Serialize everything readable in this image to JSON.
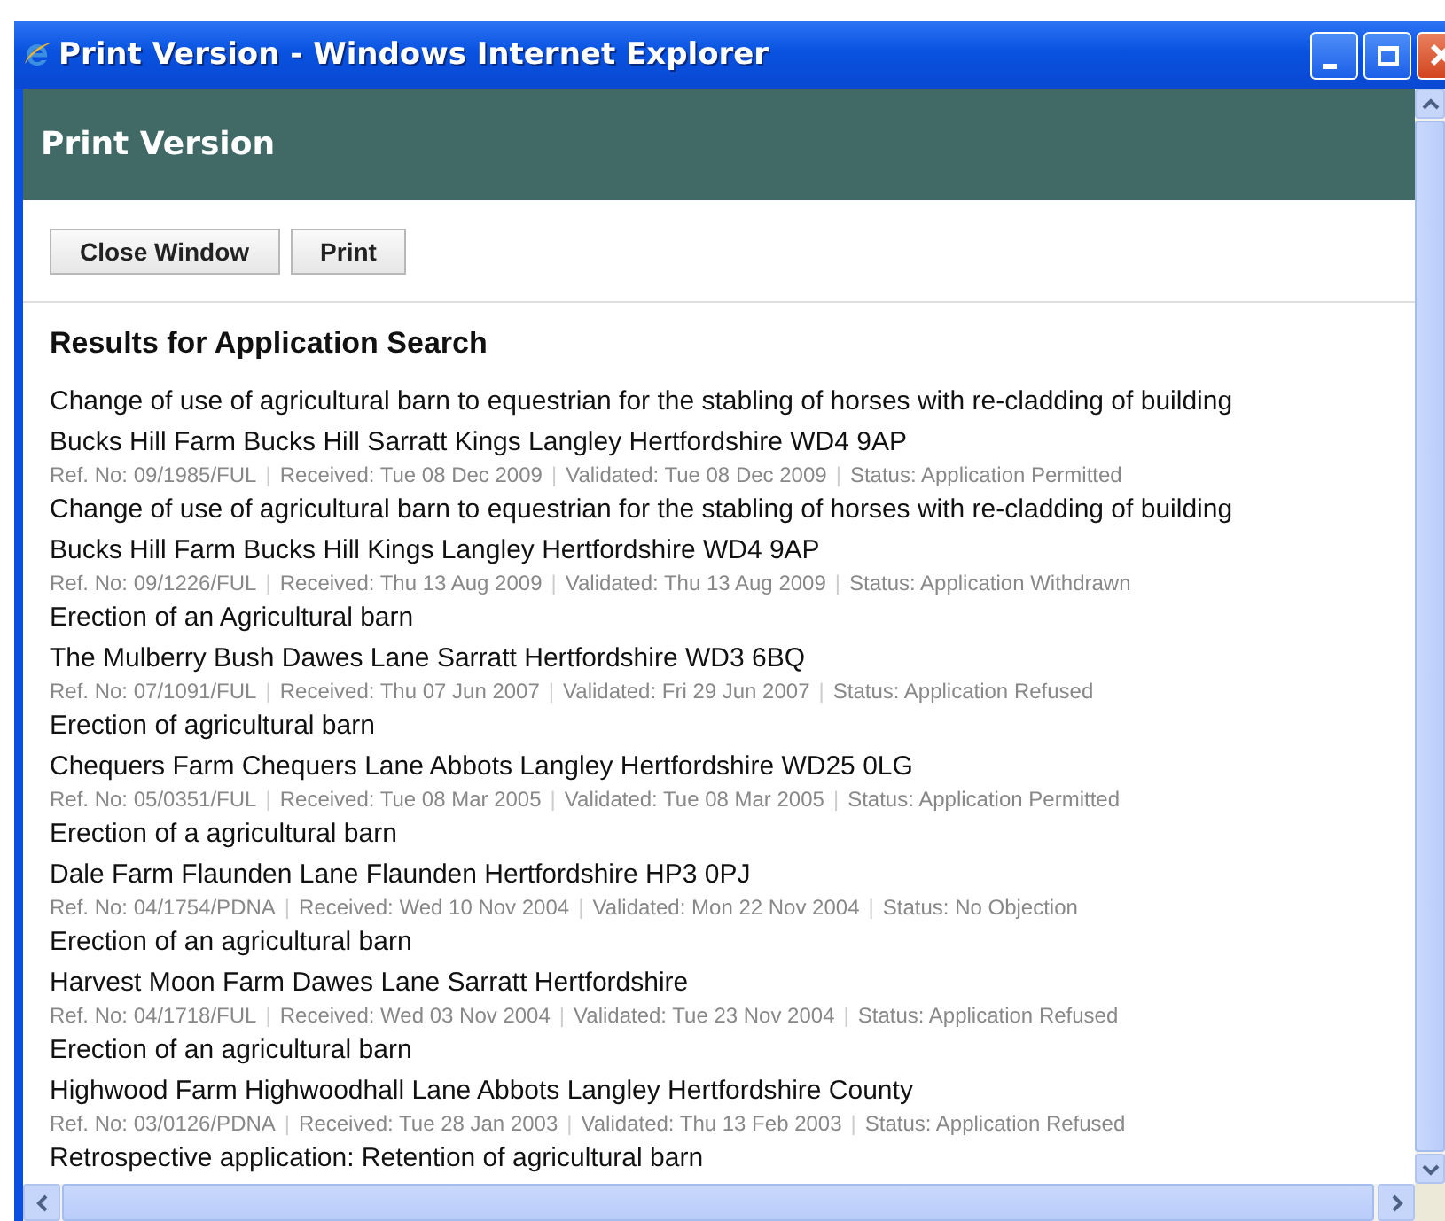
{
  "window": {
    "title": "Print Version - Windows Internet Explorer"
  },
  "page_header": "Print Version",
  "buttons": [
    "Close Window",
    "Print"
  ],
  "heading": "Results for Application Search",
  "meta_separator": "|",
  "results": [
    {
      "description": "Change of use of agricultural barn to equestrian for the stabling of horses with re-cladding of building",
      "address": "Bucks Hill Farm Bucks Hill Sarratt Kings Langley Hertfordshire WD4 9AP",
      "meta": [
        "Ref. No: 09/1985/FUL",
        "Received: Tue 08 Dec 2009",
        "Validated: Tue 08 Dec 2009",
        "Status: Application Permitted"
      ]
    },
    {
      "description": "Change of use of agricultural barn to equestrian for the stabling of horses with re-cladding of building",
      "address": "Bucks Hill Farm Bucks Hill Kings Langley Hertfordshire WD4 9AP",
      "meta": [
        "Ref. No: 09/1226/FUL",
        "Received: Thu 13 Aug 2009",
        "Validated: Thu 13 Aug 2009",
        "Status: Application Withdrawn"
      ]
    },
    {
      "description": "Erection of an Agricultural barn",
      "address": "The Mulberry Bush Dawes Lane Sarratt Hertfordshire WD3 6BQ",
      "meta": [
        "Ref. No: 07/1091/FUL",
        "Received: Thu 07 Jun 2007",
        "Validated: Fri 29 Jun 2007",
        "Status: Application Refused"
      ]
    },
    {
      "description": "Erection of agricultural barn",
      "address": "Chequers Farm Chequers Lane Abbots Langley Hertfordshire WD25 0LG",
      "meta": [
        "Ref. No: 05/0351/FUL",
        "Received: Tue 08 Mar 2005",
        "Validated: Tue 08 Mar 2005",
        "Status: Application Permitted"
      ]
    },
    {
      "description": "Erection of a agricultural barn",
      "address": "Dale Farm Flaunden Lane Flaunden Hertfordshire HP3 0PJ",
      "meta": [
        "Ref. No: 04/1754/PDNA",
        "Received: Wed 10 Nov 2004",
        "Validated: Mon 22 Nov 2004",
        "Status: No Objection"
      ]
    },
    {
      "description": "Erection of an agricultural barn",
      "address": "Harvest Moon Farm Dawes Lane Sarratt Hertfordshire",
      "meta": [
        "Ref. No: 04/1718/FUL",
        "Received: Wed 03 Nov 2004",
        "Validated: Tue 23 Nov 2004",
        "Status: Application Refused"
      ]
    },
    {
      "description": "Erection of an agricultural barn",
      "address": "Highwood Farm Highwoodhall Lane Abbots Langley Hertfordshire County",
      "meta": [
        "Ref. No: 03/0126/PDNA",
        "Received: Tue 28 Jan 2003",
        "Validated: Thu 13 Feb 2003",
        "Status: Application Refused"
      ]
    },
    {
      "description": "Retrospective application: Retention of agricultural barn"
    }
  ]
}
